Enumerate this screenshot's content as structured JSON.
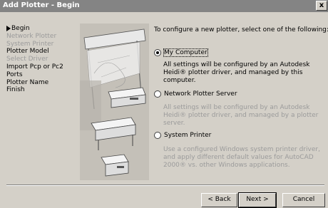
{
  "window": {
    "title": "Add Plotter - Begin",
    "close_label": "x"
  },
  "steps": [
    {
      "label": "Begin",
      "current": true,
      "enabled": true
    },
    {
      "label": "Network Plotter",
      "current": false,
      "enabled": false
    },
    {
      "label": "System Printer",
      "current": false,
      "enabled": false
    },
    {
      "label": "Plotter Model",
      "current": false,
      "enabled": true
    },
    {
      "label": "Select Driver",
      "current": false,
      "enabled": false
    },
    {
      "label": "Import Pcp or Pc2",
      "current": false,
      "enabled": true
    },
    {
      "label": "Ports",
      "current": false,
      "enabled": true
    },
    {
      "label": "Plotter Name",
      "current": false,
      "enabled": true
    },
    {
      "label": "Finish",
      "current": false,
      "enabled": true
    }
  ],
  "main": {
    "heading": "To configure a new plotter, select one of the following:",
    "options": [
      {
        "label": "My Computer",
        "checked": true,
        "description": "All settings will be configured by an Autodesk Heidi® plotter driver, and managed by this computer.",
        "description_enabled": true
      },
      {
        "label": "Network Plotter Server",
        "checked": false,
        "description": "All settings will be configured by an Autodesk Heidi® plotter driver, and managed by a plotter server.",
        "description_enabled": false
      },
      {
        "label": "System Printer",
        "checked": false,
        "description": "Use a configured Windows system printer driver, and apply different default values for AutoCAD 2000® vs. other Windows applications.",
        "description_enabled": false
      }
    ]
  },
  "buttons": {
    "back": "< Back",
    "next": "Next >",
    "cancel": "Cancel"
  }
}
